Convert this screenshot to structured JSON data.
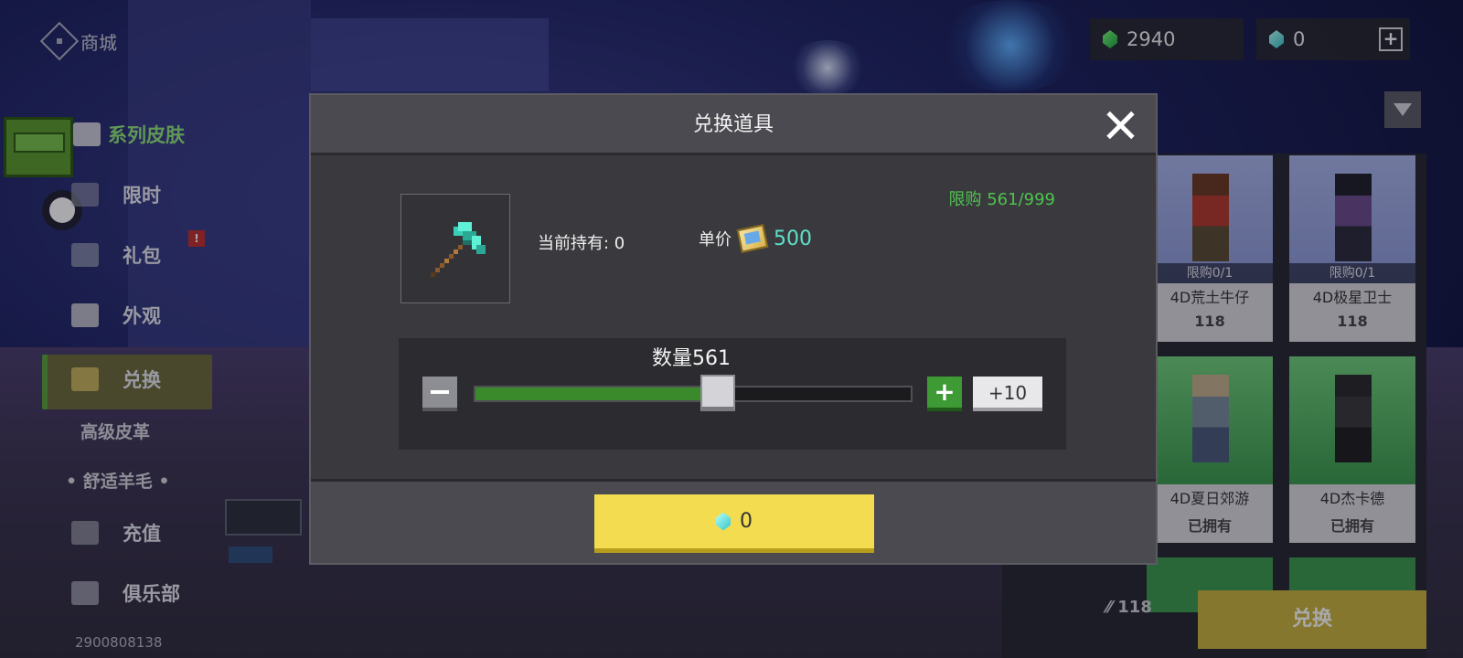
{
  "sidebar": {
    "store_label": "商城",
    "series_label": "系列皮肤",
    "items": [
      {
        "label": "限时"
      },
      {
        "label": "礼包",
        "badge": "!"
      },
      {
        "label": "外观"
      },
      {
        "label": "兑换"
      },
      {
        "label": "充值"
      },
      {
        "label": "俱乐部"
      }
    ],
    "sub_items": [
      "高级皮革",
      "• 舒适羊毛 •"
    ],
    "user_id": "2900808138"
  },
  "currency": {
    "emerald": "2940",
    "diamond": "0",
    "add_label": "+"
  },
  "shop": {
    "cards": [
      {
        "limit": "限购0/1",
        "name": "4D荒土牛仔",
        "price": "118"
      },
      {
        "limit": "限购0/1",
        "name": "4D极星卫士",
        "price": "118"
      },
      {
        "name": "4D夏日郊游",
        "price": "已拥有"
      },
      {
        "name": "4D杰卡德",
        "price": "已拥有"
      }
    ],
    "total_price": "118",
    "redeem_label": "兑换"
  },
  "dialog": {
    "title": "兑换道具",
    "held_text": "当前持有: 0",
    "unit_price_label": "单价",
    "unit_price": "500",
    "limit_text": "限购 561/999",
    "quantity_label": "数量561",
    "quantity": 561,
    "quantity_max": 999,
    "plus10_label": "+10",
    "confirm_price": "0"
  },
  "colors": {
    "confirm": "#f3dc4f",
    "slider_fill": "#3a8a2c",
    "limit_text": "#4ec24e",
    "price_text": "#5ee0c8"
  },
  "icons": [
    "dpad-icon",
    "emerald-icon",
    "diamond-icon",
    "filter-icon",
    "close-icon",
    "axe-icon",
    "ticket-icon",
    "minus-icon",
    "plus-icon"
  ]
}
